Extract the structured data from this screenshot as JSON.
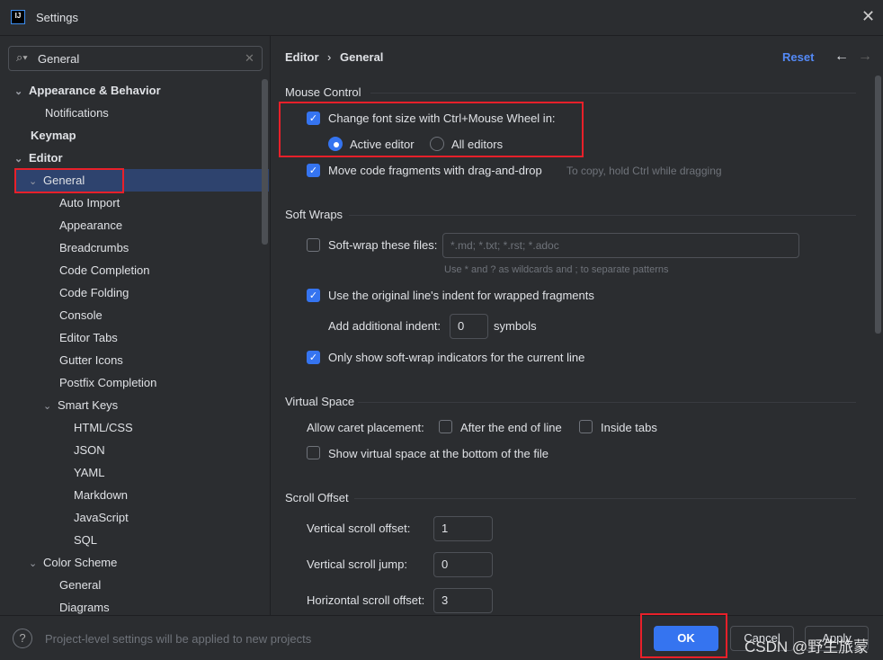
{
  "window": {
    "title": "Settings",
    "logo": "IJ"
  },
  "search": {
    "value": "General"
  },
  "tree": [
    {
      "label": "Appearance & Behavior",
      "level": 0,
      "bold": true,
      "chev": "v"
    },
    {
      "label": "Notifications",
      "level": 1
    },
    {
      "label": "Keymap",
      "level": 0,
      "bold": true
    },
    {
      "label": "Editor",
      "level": 0,
      "bold": true,
      "chev": "v"
    },
    {
      "label": "General",
      "level": 1,
      "chev": "v",
      "selected": true
    },
    {
      "label": "Auto Import",
      "level": 2
    },
    {
      "label": "Appearance",
      "level": 2
    },
    {
      "label": "Breadcrumbs",
      "level": 2
    },
    {
      "label": "Code Completion",
      "level": 2
    },
    {
      "label": "Code Folding",
      "level": 2
    },
    {
      "label": "Console",
      "level": 2
    },
    {
      "label": "Editor Tabs",
      "level": 2
    },
    {
      "label": "Gutter Icons",
      "level": 2
    },
    {
      "label": "Postfix Completion",
      "level": 2
    },
    {
      "label": "Smart Keys",
      "level": 2,
      "chev": "v"
    },
    {
      "label": "HTML/CSS",
      "level": 3
    },
    {
      "label": "JSON",
      "level": 3
    },
    {
      "label": "YAML",
      "level": 3
    },
    {
      "label": "Markdown",
      "level": 3
    },
    {
      "label": "JavaScript",
      "level": 3
    },
    {
      "label": "SQL",
      "level": 3
    },
    {
      "label": "Color Scheme",
      "level": 1,
      "chev": "v"
    },
    {
      "label": "General",
      "level": 2
    },
    {
      "label": "Diagrams",
      "level": 2
    }
  ],
  "header": {
    "crumb1": "Editor",
    "sep": "›",
    "crumb2": "General",
    "reset": "Reset"
  },
  "mouse": {
    "title": "Mouse Control",
    "font_size": "Change font size with Ctrl+Mouse Wheel in:",
    "active": "Active editor",
    "all": "All editors",
    "drag": "Move code fragments with drag-and-drop",
    "drag_hint": "To copy, hold Ctrl while dragging"
  },
  "wraps": {
    "title": "Soft Wraps",
    "files": "Soft-wrap these files:",
    "files_placeholder": "*.md; *.txt; *.rst; *.adoc",
    "files_hint": "Use * and ? as wildcards and ; to separate patterns",
    "indent": "Use the original line's indent for wrapped fragments",
    "add_indent": "Add additional indent:",
    "add_indent_value": "0",
    "symbols": "symbols",
    "only_show": "Only show soft-wrap indicators for the current line"
  },
  "virtual": {
    "title": "Virtual Space",
    "caret": "Allow caret placement:",
    "after_end": "After the end of line",
    "inside_tabs": "Inside tabs",
    "bottom": "Show virtual space at the bottom of the file"
  },
  "scroll": {
    "title": "Scroll Offset",
    "v_offset": "Vertical scroll offset:",
    "v_offset_value": "1",
    "v_jump": "Vertical scroll jump:",
    "v_jump_value": "0",
    "h_offset": "Horizontal scroll offset:",
    "h_offset_value": "3"
  },
  "footer": {
    "note": "Project-level settings will be applied to new projects",
    "ok": "OK",
    "cancel": "Cancel",
    "apply": "Apply",
    "watermark": "CSDN @野生旅蒙"
  },
  "colors": {
    "accent": "#3574f0",
    "highlight": "#e8202a",
    "selected": "#2e436e"
  }
}
